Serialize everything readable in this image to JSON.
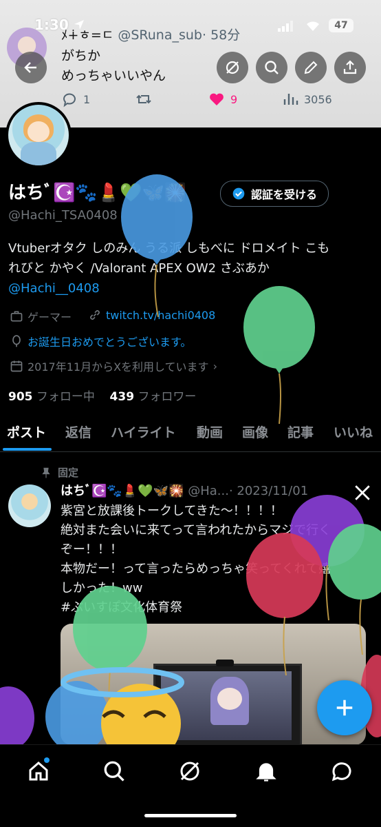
{
  "status_bar": {
    "time": "1:30",
    "battery": "47"
  },
  "top_tweet": {
    "author_prefix": "ﾒ∔ㅎ=ㄷ",
    "handle": "@SRuna_sub",
    "time": "· 58分",
    "line1": "がちか",
    "line2": "めっちゃいいやん",
    "replies": "1",
    "likes": "9",
    "views": "3056"
  },
  "profile": {
    "name": "はちﾞ☪️🐾💄💚🦋🎇",
    "handle": "@Hachi_TSA0408",
    "verify_button": "認証を受ける",
    "bio_line1": "Vtuberオタク しのみん うる派 しもべに ドロメイト こも",
    "bio_line2": "れびと かやく /Valorant APEX OW2 さぶあか",
    "bio_link": "@Hachi__0408",
    "category": "ゲーマー",
    "website": "twitch.tv/hachi0408",
    "birthday": "お誕生日おめでとうございます。",
    "joined": "2017年11月からXを利用しています",
    "following_count": "905",
    "following_label": "フォロー中",
    "followers_count": "439",
    "followers_label": "フォロワー"
  },
  "tabs": [
    "ポスト",
    "返信",
    "ハイライト",
    "動画",
    "画像",
    "記事",
    "いいね"
  ],
  "pinned_tweet": {
    "pinned_label": "固定",
    "name": "はちﾞ☪️🐾💄💚🦋🎇",
    "handle": "@Ha...",
    "date": "· 2023/11/01",
    "line1": "紫宮と放課後トークしてきた〜！！！！",
    "line2": "絶対また会いに来てって言われたからマジで行く",
    "line3": "ぞー！！！",
    "line4": "本物だー！って言ったらめっちゃ笑ってくれて嬉",
    "line5": "しかった！ww",
    "hashtag": "#ぶいすぽ文化体育祭"
  },
  "colors": {
    "accent": "#1d9bf0",
    "like": "#f91880",
    "background": "#000000"
  },
  "icons": [
    "back-icon",
    "grok-icon",
    "search-icon",
    "edit-icon",
    "share-icon",
    "reply-icon",
    "retweet-icon",
    "heart-icon",
    "views-icon",
    "home-icon",
    "explore-icon",
    "notifications-icon",
    "messages-icon"
  ]
}
